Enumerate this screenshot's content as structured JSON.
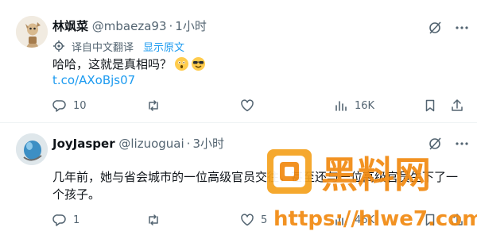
{
  "posts": [
    {
      "name": "林飒菜",
      "handle": "@mbaeza93",
      "separator": "·",
      "time": "1小时",
      "translate_label": "译自中文翻译",
      "show_original": "显示原文",
      "text": "哈哈，这就是真相吗？",
      "emojis": [
        "astonished-face",
        "smiling-face-with-sunglasses"
      ],
      "link": "t.co/AXoBjs07",
      "actions": {
        "replies": "10",
        "retweets": "",
        "likes": "",
        "views": "16K"
      }
    },
    {
      "name": "JoyJasper",
      "handle": "@lizuoguai",
      "separator": "·",
      "time": "3小时",
      "text": "几年前，她与省会城市的一位高级官员交往，甚至还与一位高级官员生下了一个孩子。",
      "actions": {
        "replies": "1",
        "retweets": "",
        "likes": "5",
        "views": "46K"
      }
    }
  ],
  "watermark": {
    "brand": "黑料网",
    "url": "https://hlwe7.com"
  },
  "colors": {
    "accent": "#1d9bf0",
    "muted": "#536471",
    "text": "#0f1419",
    "watermark": "#f28a12"
  }
}
